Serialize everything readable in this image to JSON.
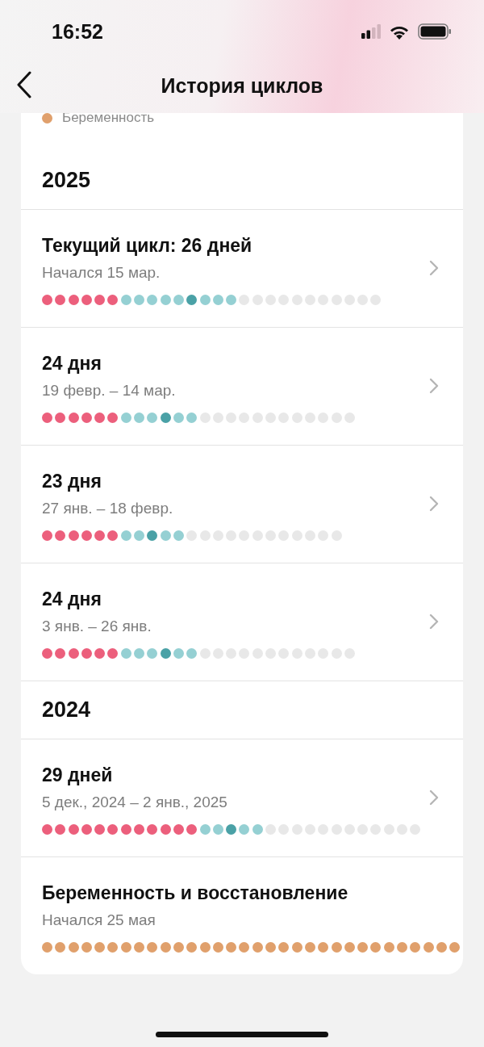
{
  "status_bar": {
    "time": "16:52"
  },
  "header": {
    "title": "История циклов"
  },
  "legend": [
    {
      "label": "Беременность",
      "color": "#e0a06c"
    }
  ],
  "sections": [
    {
      "year": "2025",
      "cycles": [
        {
          "title": "Текущий цикл: 26 дней",
          "subtitle": "Начался 15 мар.",
          "chevron": true,
          "days": [
            {
              "kind": "p"
            },
            {
              "kind": "p"
            },
            {
              "kind": "p"
            },
            {
              "kind": "p"
            },
            {
              "kind": "p"
            },
            {
              "kind": "p"
            },
            {
              "kind": "f"
            },
            {
              "kind": "f"
            },
            {
              "kind": "f"
            },
            {
              "kind": "f"
            },
            {
              "kind": "f"
            },
            {
              "kind": "o"
            },
            {
              "kind": "f"
            },
            {
              "kind": "f"
            },
            {
              "kind": "f"
            },
            {
              "kind": "e"
            },
            {
              "kind": "e"
            },
            {
              "kind": "e"
            },
            {
              "kind": "e"
            },
            {
              "kind": "e"
            },
            {
              "kind": "e"
            },
            {
              "kind": "e"
            },
            {
              "kind": "e"
            },
            {
              "kind": "e"
            },
            {
              "kind": "e"
            },
            {
              "kind": "e"
            }
          ]
        },
        {
          "title": "24 дня",
          "subtitle": "19 февр. – 14 мар.",
          "chevron": true,
          "days": [
            {
              "kind": "p"
            },
            {
              "kind": "p"
            },
            {
              "kind": "p"
            },
            {
              "kind": "p"
            },
            {
              "kind": "p"
            },
            {
              "kind": "p"
            },
            {
              "kind": "f"
            },
            {
              "kind": "f"
            },
            {
              "kind": "f"
            },
            {
              "kind": "o"
            },
            {
              "kind": "f"
            },
            {
              "kind": "f"
            },
            {
              "kind": "e"
            },
            {
              "kind": "e"
            },
            {
              "kind": "e"
            },
            {
              "kind": "e"
            },
            {
              "kind": "e"
            },
            {
              "kind": "e"
            },
            {
              "kind": "e"
            },
            {
              "kind": "e"
            },
            {
              "kind": "e"
            },
            {
              "kind": "e"
            },
            {
              "kind": "e"
            },
            {
              "kind": "e"
            }
          ]
        },
        {
          "title": "23 дня",
          "subtitle": "27 янв. – 18 февр.",
          "chevron": true,
          "days": [
            {
              "kind": "p"
            },
            {
              "kind": "p"
            },
            {
              "kind": "p"
            },
            {
              "kind": "p"
            },
            {
              "kind": "p"
            },
            {
              "kind": "p"
            },
            {
              "kind": "f"
            },
            {
              "kind": "f"
            },
            {
              "kind": "o"
            },
            {
              "kind": "f"
            },
            {
              "kind": "f"
            },
            {
              "kind": "e"
            },
            {
              "kind": "e"
            },
            {
              "kind": "e"
            },
            {
              "kind": "e"
            },
            {
              "kind": "e"
            },
            {
              "kind": "e"
            },
            {
              "kind": "e"
            },
            {
              "kind": "e"
            },
            {
              "kind": "e"
            },
            {
              "kind": "e"
            },
            {
              "kind": "e"
            },
            {
              "kind": "e"
            }
          ]
        },
        {
          "title": "24 дня",
          "subtitle": "3 янв. – 26 янв.",
          "chevron": true,
          "days": [
            {
              "kind": "p"
            },
            {
              "kind": "p"
            },
            {
              "kind": "p"
            },
            {
              "kind": "p"
            },
            {
              "kind": "p"
            },
            {
              "kind": "p"
            },
            {
              "kind": "f"
            },
            {
              "kind": "f"
            },
            {
              "kind": "f"
            },
            {
              "kind": "o"
            },
            {
              "kind": "f"
            },
            {
              "kind": "f"
            },
            {
              "kind": "e"
            },
            {
              "kind": "e"
            },
            {
              "kind": "e"
            },
            {
              "kind": "e"
            },
            {
              "kind": "e"
            },
            {
              "kind": "e"
            },
            {
              "kind": "e"
            },
            {
              "kind": "e"
            },
            {
              "kind": "e"
            },
            {
              "kind": "e"
            },
            {
              "kind": "e"
            },
            {
              "kind": "e"
            }
          ]
        }
      ]
    },
    {
      "year": "2024",
      "cycles": [
        {
          "title": "29 дней",
          "subtitle": "5 дек., 2024 – 2 янв., 2025",
          "chevron": true,
          "days": [
            {
              "kind": "p"
            },
            {
              "kind": "p"
            },
            {
              "kind": "p"
            },
            {
              "kind": "p"
            },
            {
              "kind": "p"
            },
            {
              "kind": "p"
            },
            {
              "kind": "p"
            },
            {
              "kind": "p"
            },
            {
              "kind": "p"
            },
            {
              "kind": "p"
            },
            {
              "kind": "p"
            },
            {
              "kind": "p"
            },
            {
              "kind": "f"
            },
            {
              "kind": "f"
            },
            {
              "kind": "o"
            },
            {
              "kind": "f"
            },
            {
              "kind": "f"
            },
            {
              "kind": "e"
            },
            {
              "kind": "e"
            },
            {
              "kind": "e"
            },
            {
              "kind": "e"
            },
            {
              "kind": "e"
            },
            {
              "kind": "e"
            },
            {
              "kind": "e"
            },
            {
              "kind": "e"
            },
            {
              "kind": "e"
            },
            {
              "kind": "e"
            },
            {
              "kind": "e"
            },
            {
              "kind": "e"
            }
          ]
        },
        {
          "title": "Беременность и восстановление",
          "subtitle": "Начался 25 мая",
          "chevron": false,
          "days": [
            {
              "kind": "g"
            },
            {
              "kind": "g"
            },
            {
              "kind": "g"
            },
            {
              "kind": "g"
            },
            {
              "kind": "g"
            },
            {
              "kind": "g"
            },
            {
              "kind": "g"
            },
            {
              "kind": "g"
            },
            {
              "kind": "g"
            },
            {
              "kind": "g"
            },
            {
              "kind": "g"
            },
            {
              "kind": "g"
            },
            {
              "kind": "g"
            },
            {
              "kind": "g"
            },
            {
              "kind": "g"
            },
            {
              "kind": "g"
            },
            {
              "kind": "g"
            },
            {
              "kind": "g"
            },
            {
              "kind": "g"
            },
            {
              "kind": "g"
            },
            {
              "kind": "g"
            },
            {
              "kind": "g"
            },
            {
              "kind": "g"
            },
            {
              "kind": "g"
            },
            {
              "kind": "g"
            },
            {
              "kind": "g"
            },
            {
              "kind": "g"
            },
            {
              "kind": "g"
            },
            {
              "kind": "g"
            },
            {
              "kind": "g"
            },
            {
              "kind": "g"
            },
            {
              "kind": "g"
            }
          ]
        }
      ]
    }
  ]
}
